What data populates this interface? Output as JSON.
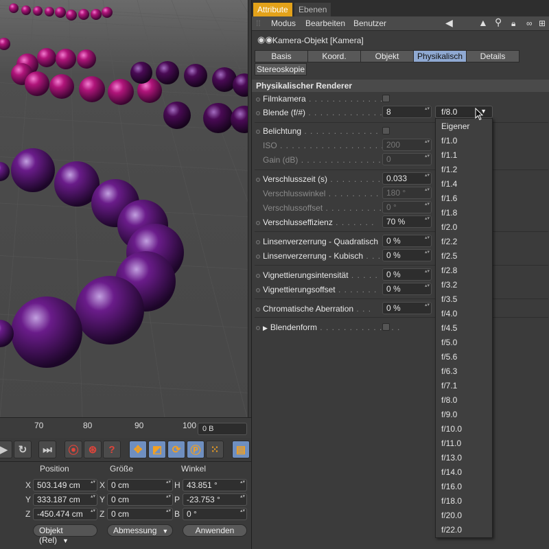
{
  "viewport": {
    "label": "3D viewport"
  },
  "timeline": {
    "ticks": [
      "70",
      "80",
      "90",
      "100"
    ],
    "frame": "0 B"
  },
  "coords": {
    "headers": {
      "position": "Position",
      "size": "Größe",
      "angle": "Winkel"
    },
    "rows": [
      {
        "pa": "X",
        "pos": "503.149 cm",
        "sa": "X",
        "size": "0 cm",
        "aa": "H",
        "angle": "43.851 °"
      },
      {
        "pa": "Y",
        "pos": "333.187 cm",
        "sa": "Y",
        "size": "0 cm",
        "aa": "P",
        "angle": "-23.753 °"
      },
      {
        "pa": "Z",
        "pos": "-450.474 cm",
        "sa": "Z",
        "size": "0 cm",
        "aa": "B",
        "angle": "0 °"
      }
    ],
    "mode_dropdown": "Objekt (Rel)",
    "size_dropdown": "Abmessung",
    "apply": "Anwenden"
  },
  "panel": {
    "tabs": [
      "Attribute",
      "Ebenen"
    ],
    "menu": [
      "Modus",
      "Bearbeiten",
      "Benutzer"
    ],
    "object_title": "Kamera-Objekt [Kamera]",
    "subtabs": [
      "Basis",
      "Koord.",
      "Objekt",
      "Physikalisch",
      "Details",
      "Stereoskopie"
    ],
    "active_subtab": "Physikalisch",
    "section": "Physikalischer Renderer",
    "props": {
      "filmkamera": "Filmkamera",
      "blende": "Blende (f/#)",
      "blende_val": "8",
      "belichtung": "Belichtung",
      "iso": "ISO",
      "iso_val": "200",
      "gain": "Gain (dB)",
      "gain_val": "0",
      "vzeit": "Verschlusszeit (s)",
      "vzeit_val": "0.033",
      "vwinkel": "Verschlusswinkel",
      "vwinkel_val": "180 °",
      "voffset": "Verschlussoffset",
      "voffset_val": "0 °",
      "veff": "Verschlusseffizienz",
      "veff_val": "70 %",
      "lq": "Linsenverzerrung - Quadratisch",
      "lq_val": "0 %",
      "lk": "Linsenverzerrung - Kubisch",
      "lk_val": "0 %",
      "vint": "Vignettierungsintensität",
      "vint_val": "0 %",
      "voff2": "Vignettierungsoffset",
      "voff2_val": "0 %",
      "chrom": "Chromatische Aberration",
      "chrom_val": "0 %",
      "bform": "Blendenform"
    },
    "fstop_selected": "f/8.0",
    "fstop_options": [
      "Eigener",
      "f/1.0",
      "f/1.1",
      "f/1.2",
      "f/1.4",
      "f/1.6",
      "f/1.8",
      "f/2.0",
      "f/2.2",
      "f/2.5",
      "f/2.8",
      "f/3.2",
      "f/3.5",
      "f/4.0",
      "f/4.5",
      "f/5.0",
      "f/5.6",
      "f/6.3",
      "f/7.1",
      "f/8.0",
      "f/9.0",
      "f/10.0",
      "f/11.0",
      "f/13.0",
      "f/14.0",
      "f/16.0",
      "f/18.0",
      "f/20.0",
      "f/22.0"
    ]
  },
  "colors": {
    "accent_tab": "#e3a21a",
    "active_subtab": "#8fa9d2",
    "sphere_magenta": "#b0157a",
    "sphere_purple": "#4a0a55"
  }
}
